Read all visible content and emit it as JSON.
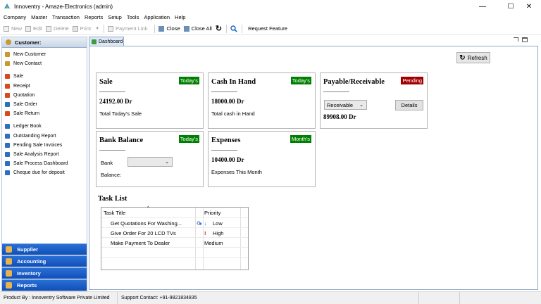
{
  "window": {
    "title": "Innoventry - Amaze-Electronics (admin)",
    "controls": {
      "minimize": "—",
      "maximize": "☐",
      "close": "✕"
    }
  },
  "menu": [
    "Company",
    "Master",
    "Transaction",
    "Reports",
    "Setup",
    "Tools",
    "Application",
    "Help"
  ],
  "toolbar": {
    "new": "New",
    "edit": "Edit",
    "delete": "Delete",
    "print": "Print",
    "payment_link": "Payment Link",
    "close": "Close",
    "close_all": "Close All",
    "request_feature": "Request Feature"
  },
  "sidebar": {
    "header": "Customer:",
    "items": [
      {
        "label": "New Customer",
        "icon": "new-customer-icon",
        "color": "#c99a2e"
      },
      {
        "label": "New Contact",
        "icon": "new-contact-icon",
        "color": "#c99a2e"
      },
      {
        "label": "Sale",
        "icon": "sale-icon",
        "color": "#d84a1b"
      },
      {
        "label": "Receipt",
        "icon": "receipt-icon",
        "color": "#d84a1b"
      },
      {
        "label": "Quotation",
        "icon": "quotation-icon",
        "color": "#d84a1b"
      },
      {
        "label": "Sale Order",
        "icon": "sale-order-icon",
        "color": "#2d6fc0"
      },
      {
        "label": "Sale Return",
        "icon": "sale-return-icon",
        "color": "#d84a1b"
      },
      {
        "label": "Ledger Book",
        "icon": "ledger-book-icon",
        "color": "#2d6fc0"
      },
      {
        "label": "Outstanding Report",
        "icon": "report-icon",
        "color": "#2d6fc0"
      },
      {
        "label": "Pending Sale Invoices",
        "icon": "report-icon",
        "color": "#2d6fc0"
      },
      {
        "label": "Sale Analysis Report",
        "icon": "report-icon",
        "color": "#2d6fc0"
      },
      {
        "label": "Sale Process Dashboard",
        "icon": "dashboard-icon",
        "color": "#2d6fc0"
      },
      {
        "label": "Cheque due for deposit",
        "icon": "cheque-icon",
        "color": "#2d6fc0"
      }
    ],
    "categories": [
      "Supplier",
      "Accounting",
      "Inventory",
      "Reports"
    ]
  },
  "tab": {
    "label": "Dashboard"
  },
  "refresh_label": "Refresh",
  "cards": {
    "sale": {
      "title": "Sale",
      "badge": "Today's",
      "value": "24192.00 Dr",
      "subtitle": "Total Today's Sale"
    },
    "cash": {
      "title": "Cash In Hand",
      "badge": "Today's",
      "value": "18000.00 Dr",
      "subtitle": "Total cash in Hand"
    },
    "payable": {
      "title": "Payable/Receivable",
      "badge": "Pending",
      "select_value": "Receivable",
      "details_label": "Details",
      "value": "89908.00 Dr"
    },
    "bank": {
      "title": "Bank Balance",
      "badge": "Today's",
      "bank_label": "Bank",
      "balance_label": "Balance:",
      "select_value": ""
    },
    "expenses": {
      "title": "Expenses",
      "badge": "Month's",
      "value": "10400.00 Dr",
      "subtitle": "Expenses This Month"
    }
  },
  "task_list": {
    "title": "Task List",
    "columns": [
      "Task Title",
      "Priority"
    ],
    "rows": [
      {
        "title": "Get Quotations For Washing...",
        "priority": "Low",
        "priority_icon": "arrow-down-icon"
      },
      {
        "title": "Give Order For 20 LCD TVs",
        "priority": "High",
        "priority_icon": "exclamation-icon"
      },
      {
        "title": "Make Payment To Dealer",
        "priority": "Medium",
        "priority_icon": ""
      }
    ]
  },
  "status": {
    "product": "Product By : Innoventry Software Private Limited",
    "support": "Support Contact: +91-9821834835"
  }
}
